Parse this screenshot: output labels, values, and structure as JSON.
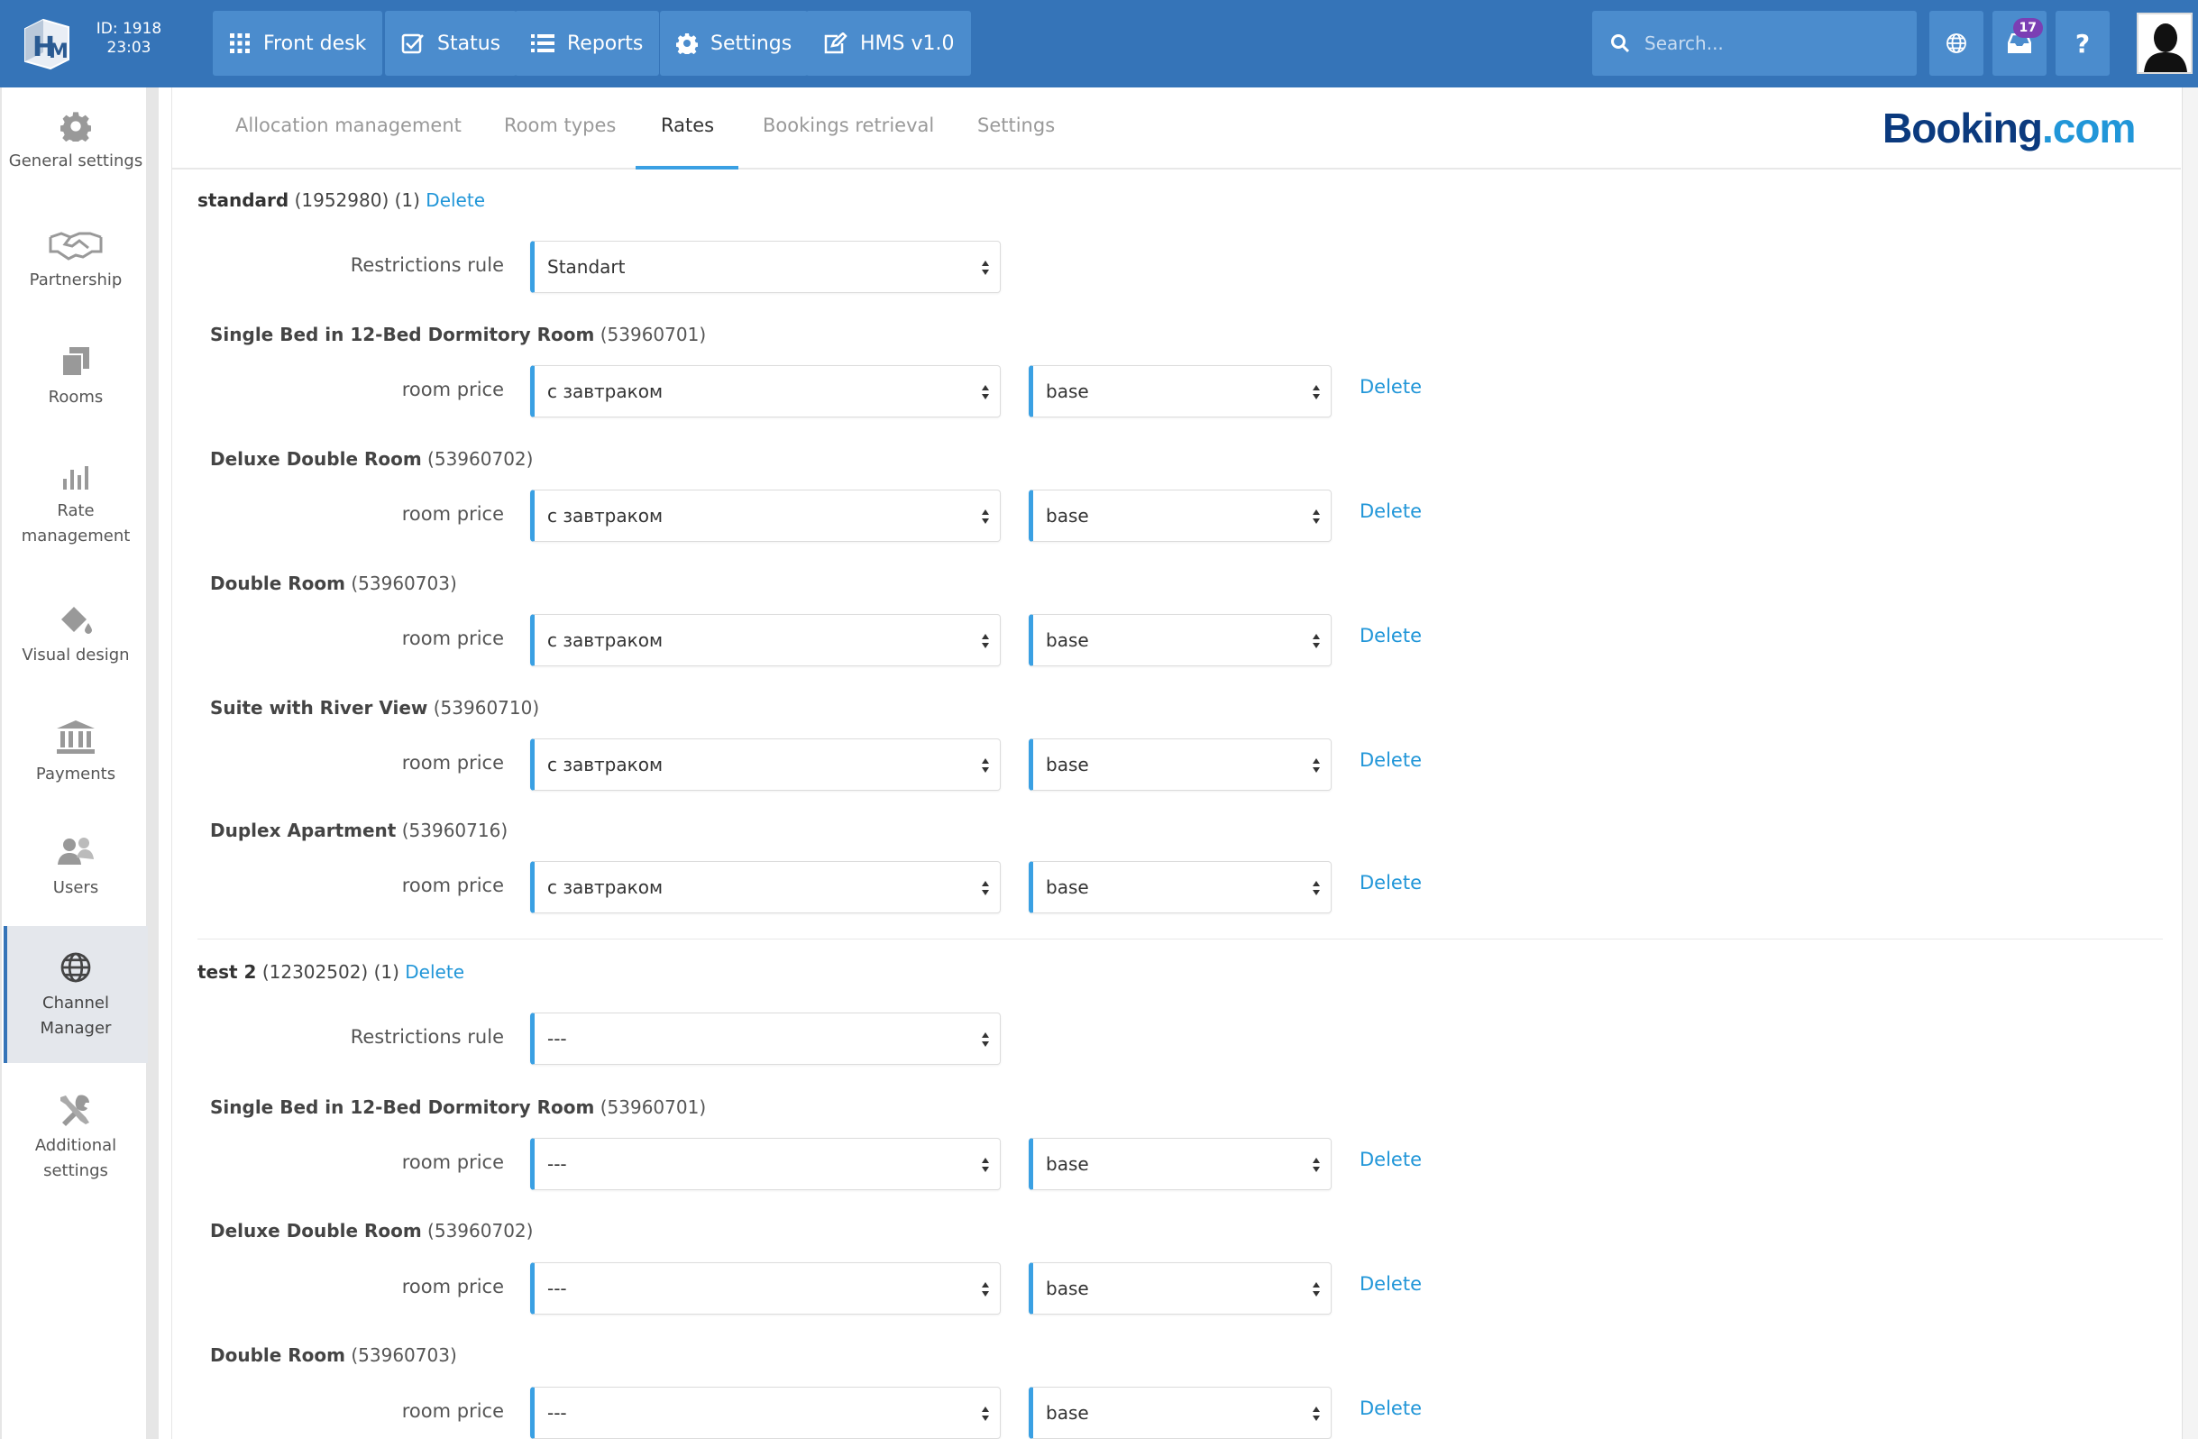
{
  "topbar": {
    "id_label": "ID: 1918",
    "time": "23:03",
    "nav": [
      {
        "label": "Front desk",
        "icon": "grid-icon"
      },
      {
        "label": "Status",
        "icon": "checkbox-icon"
      },
      {
        "label": "Reports",
        "icon": "list-icon"
      },
      {
        "label": "Settings",
        "icon": "gear-icon"
      },
      {
        "label": "HMS v1.0",
        "icon": "edit-icon"
      }
    ],
    "search_placeholder": "Search...",
    "notifications_count": "17",
    "help_label": "?"
  },
  "sidebar": {
    "items": [
      {
        "label": "General settings",
        "icon": "gear-icon"
      },
      {
        "label": "Partnership",
        "icon": "handshake-icon"
      },
      {
        "label": "Rooms",
        "icon": "rooms-icon"
      },
      {
        "label": "Rate management",
        "icon": "bar-chart-icon"
      },
      {
        "label": "Visual design",
        "icon": "paint-bucket-icon"
      },
      {
        "label": "Payments",
        "icon": "bank-icon"
      },
      {
        "label": "Users",
        "icon": "users-icon"
      },
      {
        "label": "Channel Manager",
        "icon": "globe-icon",
        "active": true
      },
      {
        "label": "Additional settings",
        "icon": "tools-icon"
      }
    ]
  },
  "tabs": [
    {
      "label": "Allocation management"
    },
    {
      "label": "Room types"
    },
    {
      "label": "Rates",
      "active": true
    },
    {
      "label": "Bookings retrieval"
    },
    {
      "label": "Settings"
    }
  ],
  "brand": {
    "part1": "Booking",
    "part2": ".com"
  },
  "colors": {
    "topbar": "#3574b8",
    "button": "#4b8ccd",
    "accent": "#3aa0e3",
    "link": "#2196d8",
    "badge": "#7b3fb4"
  },
  "labels": {
    "restrictions_rule": "Restrictions rule",
    "room_price": "room price",
    "delete": "Delete"
  },
  "rates": [
    {
      "name": "standard",
      "meta": "(1952980) (1)",
      "restrictions_rule": "Standart",
      "rooms": [
        {
          "name": "Single Bed in 12-Bed Dormitory Room",
          "id": "(53960701)",
          "price": "с завтраком",
          "type": "base"
        },
        {
          "name": "Deluxe Double Room",
          "id": "(53960702)",
          "price": "с завтраком",
          "type": "base"
        },
        {
          "name": "Double Room",
          "id": "(53960703)",
          "price": "с завтраком",
          "type": "base"
        },
        {
          "name": "Suite with River View",
          "id": "(53960710)",
          "price": "с завтраком",
          "type": "base"
        },
        {
          "name": "Duplex Apartment",
          "id": "(53960716)",
          "price": "с завтраком",
          "type": "base"
        }
      ]
    },
    {
      "name": "test 2",
      "meta": "(12302502) (1)",
      "restrictions_rule": "---",
      "rooms": [
        {
          "name": "Single Bed in 12-Bed Dormitory Room",
          "id": "(53960701)",
          "price": "---",
          "type": "base"
        },
        {
          "name": "Deluxe Double Room",
          "id": "(53960702)",
          "price": "---",
          "type": "base"
        },
        {
          "name": "Double Room",
          "id": "(53960703)",
          "price": "---",
          "type": "base"
        }
      ]
    }
  ]
}
